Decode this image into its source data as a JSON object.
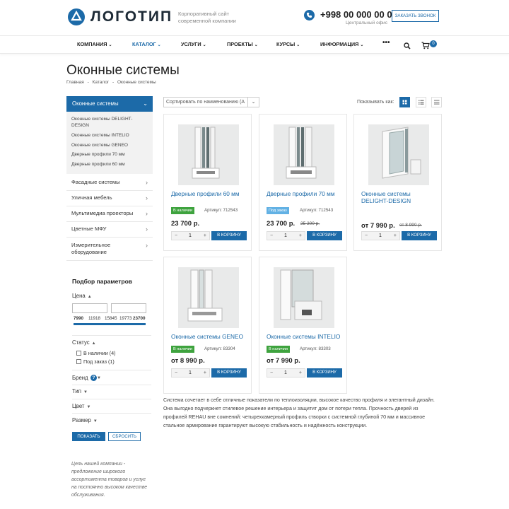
{
  "header": {
    "logo_text": "ЛОГОТИП",
    "tagline": "Корпоративный сайт современной компании",
    "phone": "+998 00 000 00 00",
    "phone_sub": "Центральный офис",
    "callback_label": "ЗАКАЗАТЬ ЗВОНОК",
    "cart_count": "0"
  },
  "nav": {
    "items": [
      {
        "label": "КОМПАНИЯ"
      },
      {
        "label": "КАТАЛОГ"
      },
      {
        "label": "УСЛУГИ"
      },
      {
        "label": "ПРОЕКТЫ"
      },
      {
        "label": "КУРСЫ"
      },
      {
        "label": "ИНФОРМАЦИЯ"
      }
    ],
    "more": "•••"
  },
  "page": {
    "title": "Оконные системы",
    "breadcrumb": [
      "Главная",
      "-",
      "Каталог",
      "-",
      "Оконные системы"
    ]
  },
  "sidebar": {
    "active": "Оконные системы",
    "subitems": [
      "Оконные системы DELIGHT-DESIGN",
      "Оконные системы INTELIO",
      "Оконные системы GENEO",
      "Дверные профили 70 мм",
      "Дверные профили 60 мм"
    ],
    "items": [
      "Фасадные системы",
      "Уличная мебель",
      "Мультимедиа проекторы",
      "Цветные МФУ",
      "Измерительное оборудование"
    ],
    "quote": "Цель нашей компании - предложение широкого ассортимента товаров и услуг на постоянно высоком качестве обслуживания."
  },
  "filter": {
    "title": "Подбор параметров",
    "price_label": "Цена",
    "range_ticks": [
      "7990",
      "11918",
      "15845",
      "19773",
      "23700"
    ],
    "status_label": "Статус",
    "status_options": [
      "В наличии (4)",
      "Под заказ (1)"
    ],
    "brand_label": "Бренд",
    "type_label": "Тип",
    "color_label": "Цвет",
    "size_label": "Размер",
    "show_label": "ПОКАЗАТЬ",
    "reset_label": "СБРОСИТЬ"
  },
  "toolbar": {
    "sort_label": "Сортировать по наименованию (А",
    "view_label": "Показывать как:"
  },
  "products": [
    {
      "name": "Дверные профили 60 мм",
      "badge": "В наличии",
      "article": "Артикул: 712543",
      "price": "23 700 р.",
      "old_price": "",
      "qty": "1",
      "buy": "В КОРЗИНУ"
    },
    {
      "name": "Дверные профили 70 мм",
      "badge": "Под заказ",
      "article": "Артикул: 712543",
      "price": "23 700 р.",
      "old_price": "25 200 р.",
      "qty": "1",
      "buy": "В КОРЗИНУ"
    },
    {
      "name": "Оконные системы DELIGHT-DESIGN",
      "badge": "",
      "article": "",
      "price": "от 7 990 р.",
      "old_price": "от 8 990 р.",
      "qty": "1",
      "buy": "В КОРЗИНУ"
    },
    {
      "name": "Оконные системы GENEO",
      "badge": "В наличии",
      "article": "Артикул: 83304",
      "price": "от 8 990 р.",
      "old_price": "",
      "qty": "1",
      "buy": "В КОРЗИНУ"
    },
    {
      "name": "Оконные системы INTELIO",
      "badge": "В наличии",
      "article": "Артикул: 83303",
      "price": "от 7 990 р.",
      "old_price": "",
      "qty": "1",
      "buy": "В КОРЗИНУ"
    }
  ],
  "description": "Система сочетает в себе отличные показатели по теплоизоляции, высокое качество профиля и элегантный дизайн. Она выгодно подчеркнет стилевое решение интерьера и защитит дом от потери тепла. Прочность дверей из профилей REHAU вне сомнений: четырехкамерный профиль створки с системной глубиной 70 мм и массивное стальное армирование гарантируют высокую стабильность и надёжность конструкции.",
  "colors": {
    "accent": "#1c6aa8",
    "in_stock": "#3ea33e",
    "on_order": "#62b1e4"
  },
  "icons": [
    "logo-icon",
    "phone-icon",
    "search-icon",
    "cart-icon",
    "chevron-down-icon",
    "chevron-right-icon",
    "help-icon",
    "grid-view-icon",
    "list-view-icon",
    "table-view-icon"
  ]
}
